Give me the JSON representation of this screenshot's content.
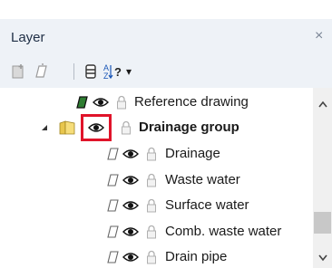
{
  "panel": {
    "title": "Layer",
    "close_glyph": "×"
  },
  "toolbar": {
    "buttons": [
      {
        "icon": "new-layer-icon"
      },
      {
        "icon": "edit-layer-icon"
      },
      {
        "icon": "layer-stack-icon"
      },
      {
        "icon": "sort-az-icon",
        "dropdown": "▾"
      }
    ]
  },
  "tree": {
    "rows": [
      {
        "label": "Reference drawing",
        "level": 0,
        "bold": false,
        "pen_color": "#2e7d32"
      },
      {
        "label": "Drainage group",
        "level": 0,
        "bold": true,
        "expanded": true,
        "is_group": true
      },
      {
        "label": "Drainage",
        "level": 1,
        "bold": false
      },
      {
        "label": "Waste water",
        "level": 1,
        "bold": false
      },
      {
        "label": "Surface water",
        "level": 1,
        "bold": false
      },
      {
        "label": "Comb. waste water",
        "level": 1,
        "bold": false
      },
      {
        "label": "Drain pipe",
        "level": 1,
        "bold": false
      }
    ]
  },
  "colors": {
    "highlight": "#e0142a",
    "header_bg": "#eef2f7"
  }
}
